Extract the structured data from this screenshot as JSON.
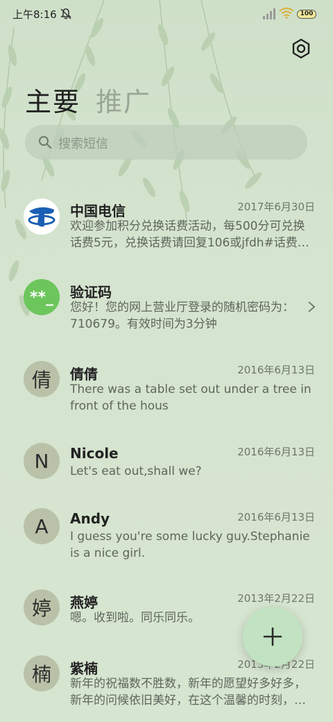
{
  "status": {
    "time": "上午8:16",
    "battery": "100",
    "icons": [
      "mute-icon",
      "signal-icon",
      "wifi-icon",
      "battery-icon"
    ]
  },
  "tabs": {
    "main": "主要",
    "promo": "推广"
  },
  "search": {
    "placeholder": "搜索短信"
  },
  "messages": [
    {
      "sender": "中国电信",
      "date": "2017年6月30日",
      "preview": "欢迎参加积分兑换话费活动，每500分可兑换话费5元，兑换话费请回复106或jfdh#话费…",
      "avatar_type": "china-telecom-logo"
    },
    {
      "sender": "验证码",
      "date": "",
      "preview": "您好！您的网上营业厅登录的随机密码为：710679。有效时间为3分钟",
      "avatar_text": "**_",
      "avatar_color": "#6cc65c"
    },
    {
      "sender": "倩倩",
      "date": "2016年6月13日",
      "preview": "There was a table set out under a tree in front of the hous",
      "avatar_text": "倩"
    },
    {
      "sender": "Nicole",
      "date": "2016年6月13日",
      "preview": "Let's eat out,shall we?",
      "avatar_text": "N"
    },
    {
      "sender": "Andy",
      "date": "2016年6月13日",
      "preview": "I guess you're some lucky guy.Stephanie is a nice girl.",
      "avatar_text": "A"
    },
    {
      "sender": "燕婷",
      "date": "2013年2月22日",
      "preview": "嗯。收到啦。同乐同乐。",
      "avatar_text": "婷"
    },
    {
      "sender": "紫楠",
      "date": "2013年2月22日",
      "preview": "新年的祝福数不胜数，新年的愿望好多好多，新年的问候依旧美好，在这个温馨的时刻，…",
      "avatar_text": "楠"
    }
  ],
  "colors": {
    "background": "#d3e2cd",
    "fab": "#c2e3c2",
    "verify_avatar": "#6cc65c",
    "telecom_blue": "#1a5fb4"
  }
}
